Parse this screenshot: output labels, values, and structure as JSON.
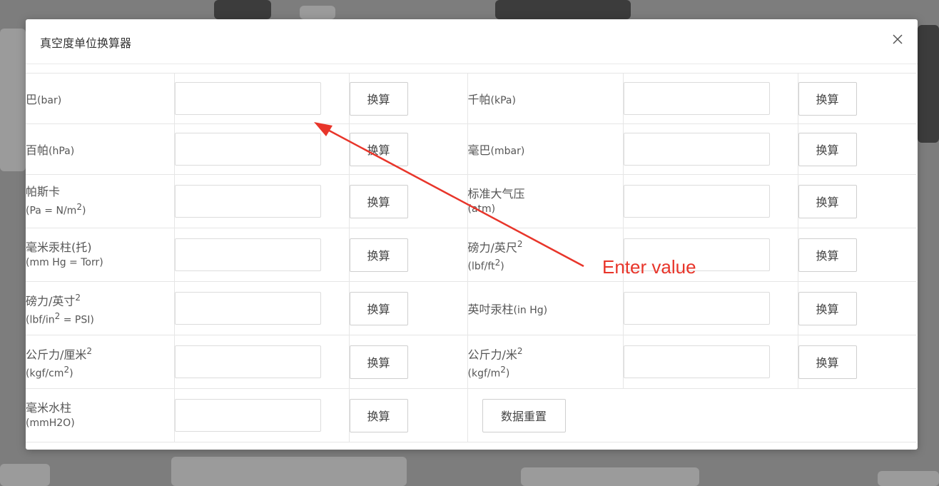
{
  "modal": {
    "title": "真空度单位换算器",
    "close_icon": "close-icon"
  },
  "rows": [
    {
      "left": {
        "main": "巴",
        "unit": "(bar)",
        "button": "换算",
        "value": ""
      },
      "right": {
        "main": "千帕",
        "unit": "(kPa)",
        "button": "换算",
        "value": ""
      }
    },
    {
      "left": {
        "main": "百帕",
        "unit": "(hPa)",
        "button": "换算",
        "value": ""
      },
      "right": {
        "main": "毫巴",
        "unit": "(mbar)",
        "button": "换算",
        "value": ""
      }
    },
    {
      "left": {
        "main": "帕斯卡",
        "sub_prefix": "(Pa = N/m",
        "sub_sup": "2",
        "sub_suffix": ")",
        "button": "换算",
        "value": ""
      },
      "right": {
        "main": "标准大气压",
        "sub": "(atm)",
        "button": "换算",
        "value": ""
      }
    },
    {
      "left": {
        "main": "毫米汞柱(托)",
        "sub": "(mm Hg = Torr)",
        "button": "换算",
        "value": ""
      },
      "right": {
        "main": "磅力/英尺",
        "main_sup": "2",
        "sub_prefix": "(lbf/ft",
        "sub_sup": "2",
        "sub_suffix": ")",
        "button": "换算",
        "value": ""
      }
    },
    {
      "left": {
        "main": "磅力/英寸",
        "main_sup": "2",
        "sub_prefix": "(lbf/in",
        "sub_sup": "2",
        "sub_suffix": " = PSI)",
        "button": "换算",
        "value": ""
      },
      "right": {
        "main": "英吋汞柱",
        "unit": "(in Hg)",
        "button": "换算",
        "value": ""
      }
    },
    {
      "left": {
        "main": "公斤力/厘米",
        "main_sup": "2",
        "sub_prefix": "(kgf/cm",
        "sub_sup": "2",
        "sub_suffix": ")",
        "button": "换算",
        "value": ""
      },
      "right": {
        "main": "公斤力/米",
        "main_sup": "2",
        "sub_prefix": "(kgf/m",
        "sub_sup": "2",
        "sub_suffix": ")",
        "button": "换算",
        "value": ""
      }
    },
    {
      "left": {
        "main": "毫米水柱",
        "sub": "(mmH2O)",
        "button": "换算",
        "value": ""
      },
      "reset_button": "数据重置"
    }
  ],
  "annotation": {
    "text": "Enter value",
    "color": "#e8352a"
  },
  "colors": {
    "overlay": "#7d7d7d",
    "border": "#e6e6e6",
    "text": "#555555"
  }
}
